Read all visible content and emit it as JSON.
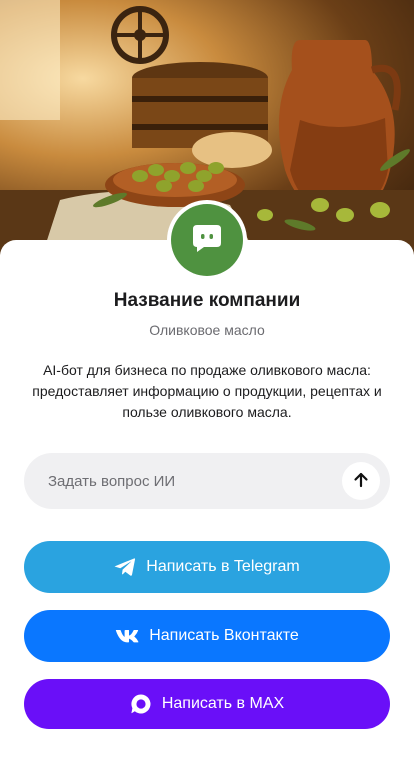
{
  "hero": {
    "icon": "olive-oil-still-life-illustration"
  },
  "company": {
    "avatar_icon": "bot-chat-icon",
    "name": "Название компании",
    "category": "Оливковое масло",
    "description": "AI-бот для бизнеса по продаже оливкового масла: предоставляет информацию о продукции, рецептах и пользе оливкового масла."
  },
  "ask": {
    "placeholder": "Задать вопрос ИИ",
    "send_icon": "arrow-up-icon"
  },
  "actions": {
    "telegram": {
      "label": "Написать в Telegram",
      "icon": "telegram-icon",
      "color": "#2aa3e0"
    },
    "vk": {
      "label": "Написать Вконтакте",
      "icon": "vk-icon",
      "color": "#0a77ff"
    },
    "max": {
      "label": "Написать в MAX",
      "icon": "max-icon",
      "color": "#6a0ff8"
    }
  },
  "colors": {
    "avatar_bg": "#4f9240"
  }
}
